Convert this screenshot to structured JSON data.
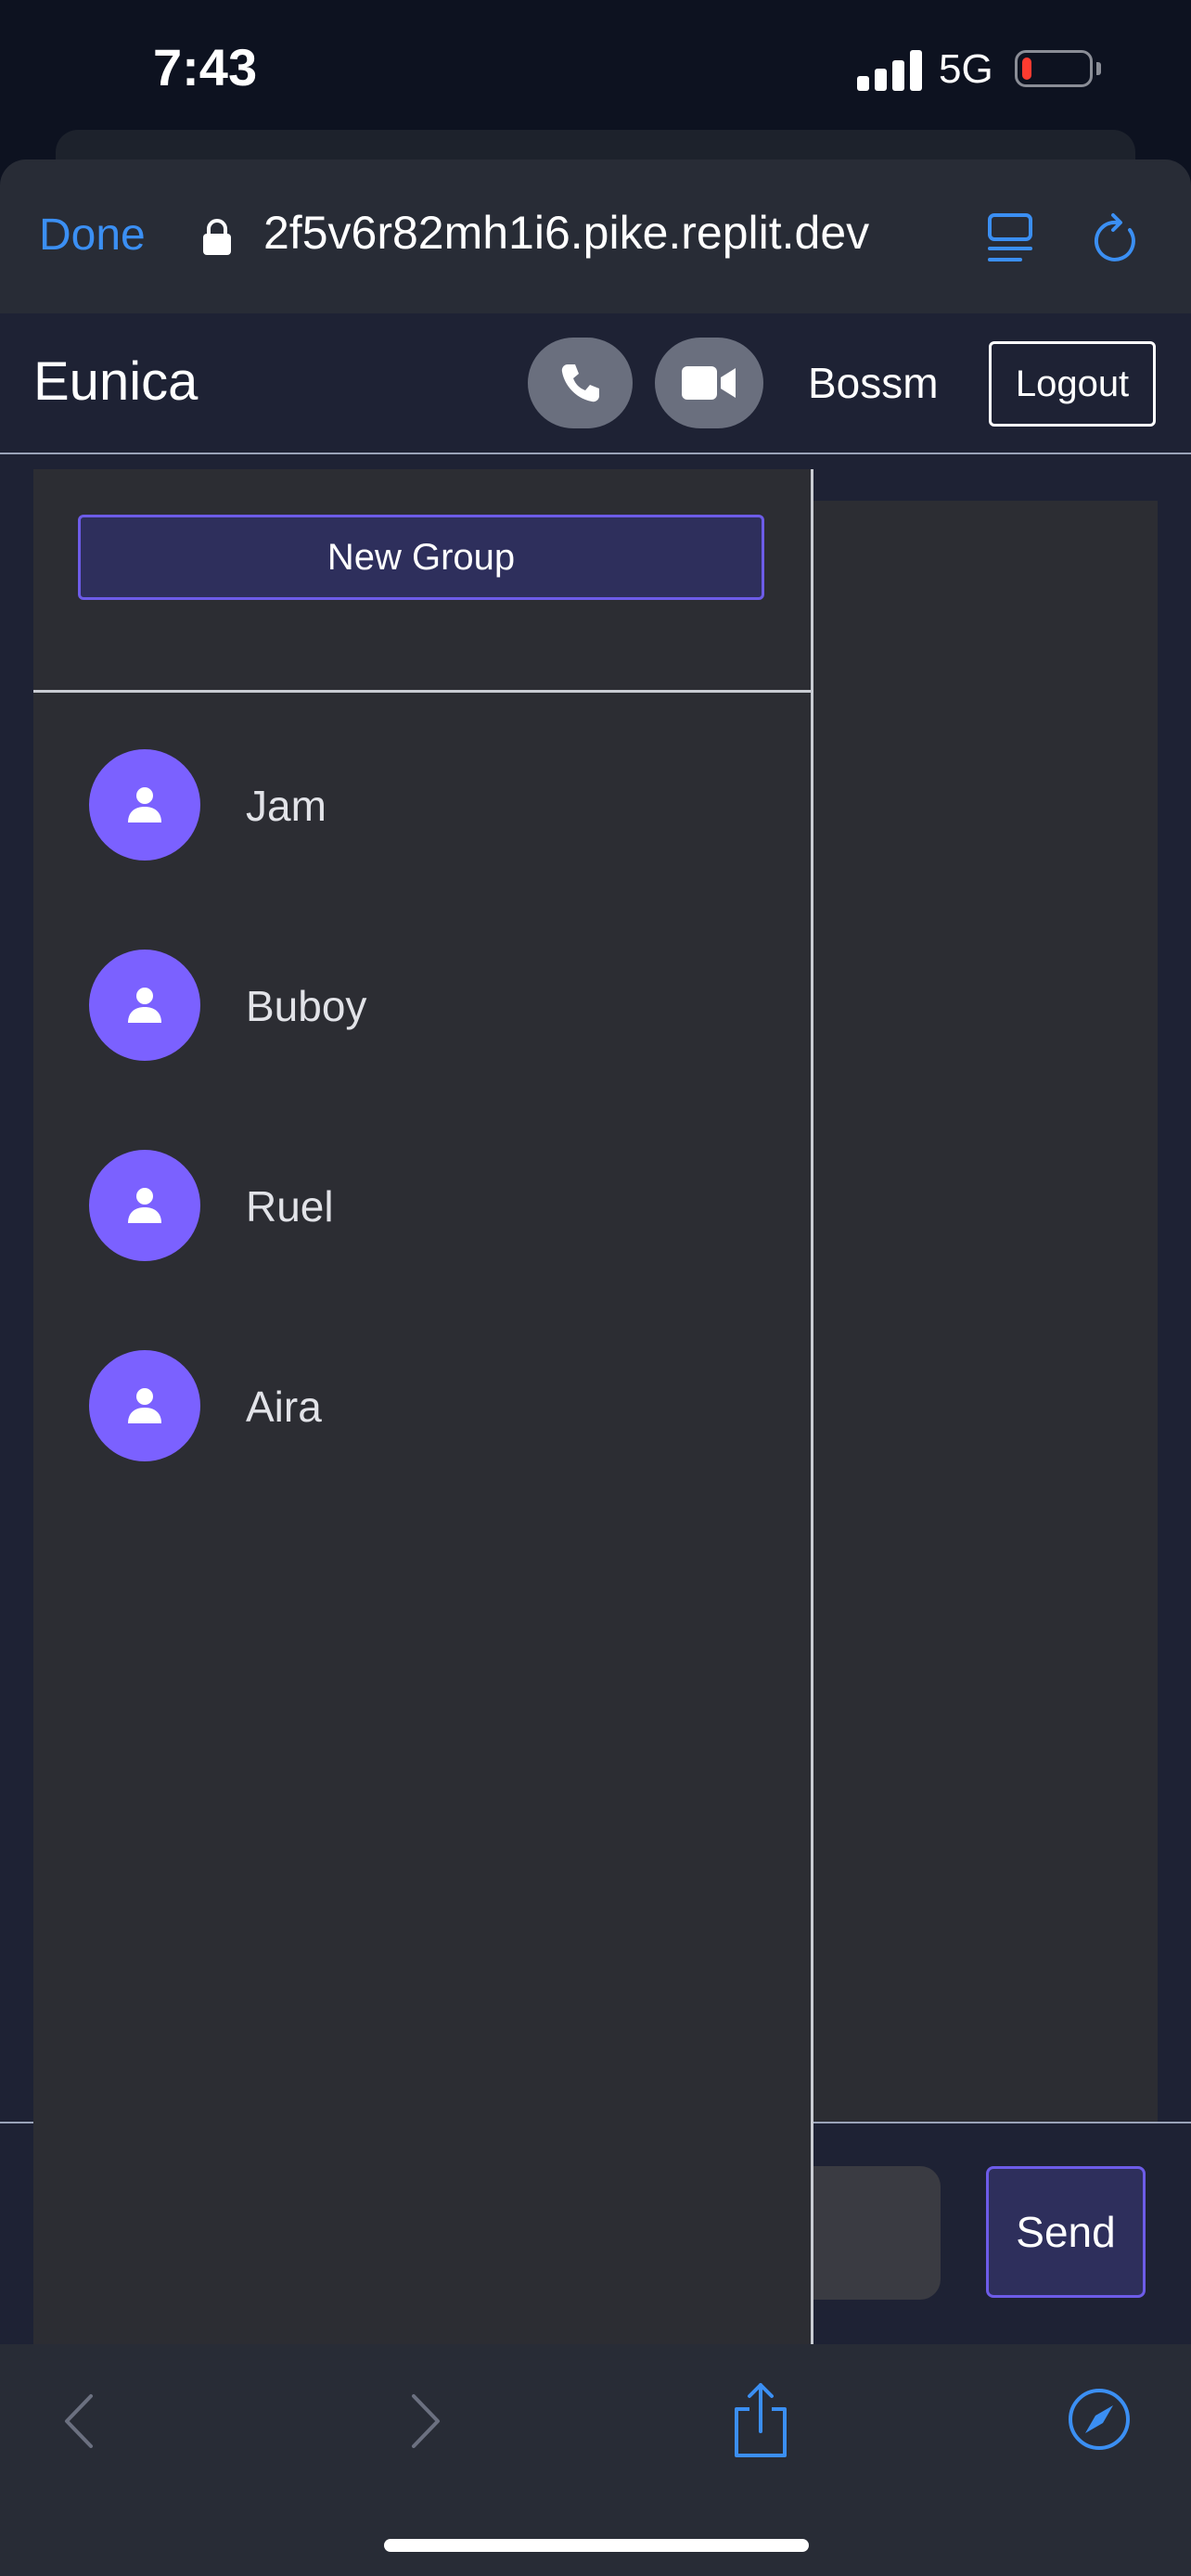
{
  "status": {
    "time": "7:43",
    "network": "5G",
    "battery_level": 0.15,
    "battery_color": "#ff3b30"
  },
  "browser": {
    "done_label": "Done",
    "url": "2f5v6r82mh1i6.pike.replit.dev",
    "accent": "#3b8ff3"
  },
  "app": {
    "title": "Eunica",
    "user_name": "Bossm",
    "logout_label": "Logout",
    "accent": "#7b61ff"
  },
  "sidebar": {
    "new_group_label": "New Group",
    "contacts": [
      {
        "name": "Jam"
      },
      {
        "name": "Buboy"
      },
      {
        "name": "Ruel"
      },
      {
        "name": "Aira"
      }
    ]
  },
  "composer": {
    "send_label": "Send"
  },
  "icons": [
    "lock-icon",
    "reader-icon",
    "reload-icon",
    "phone-icon",
    "video-camera-icon",
    "user-icon",
    "chevron-left-icon",
    "chevron-right-icon",
    "share-icon",
    "compass-icon"
  ]
}
